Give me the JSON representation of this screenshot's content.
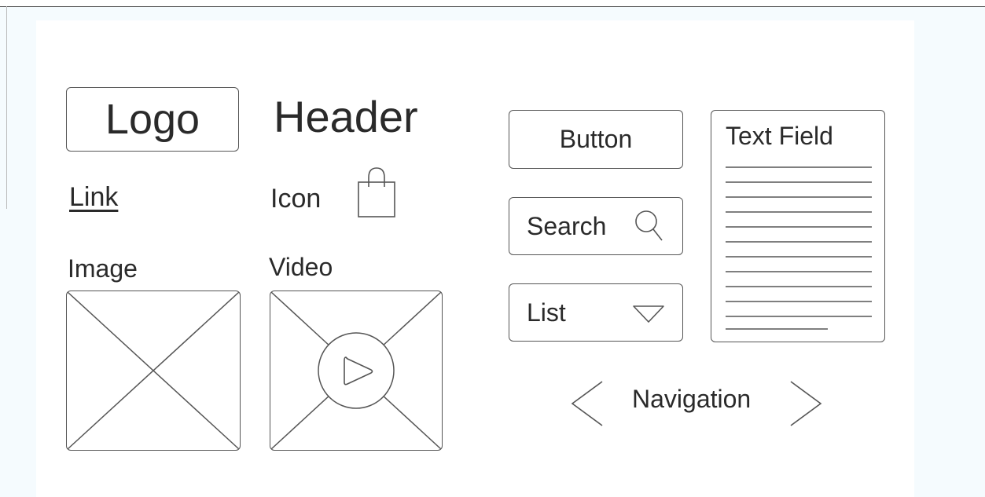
{
  "wireframe": {
    "logo_label": "Logo",
    "header_label": "Header",
    "link_label": "Link",
    "icon_label": "Icon",
    "image_label": "Image",
    "video_label": "Video",
    "button_label": "Button",
    "search_label": "Search",
    "list_label": "List",
    "text_field_label": "Text Field",
    "navigation_label": "Navigation"
  },
  "icons": {
    "bag": "shopping-bag-icon",
    "search": "magnifier-icon",
    "dropdown": "triangle-down-icon",
    "play": "play-icon",
    "prev": "chevron-left-icon",
    "next": "chevron-right-icon"
  },
  "colors": {
    "stroke": "#555555",
    "text": "#2a2a2a",
    "page_background": "#f5fbfe",
    "sheet_background": "#ffffff"
  }
}
